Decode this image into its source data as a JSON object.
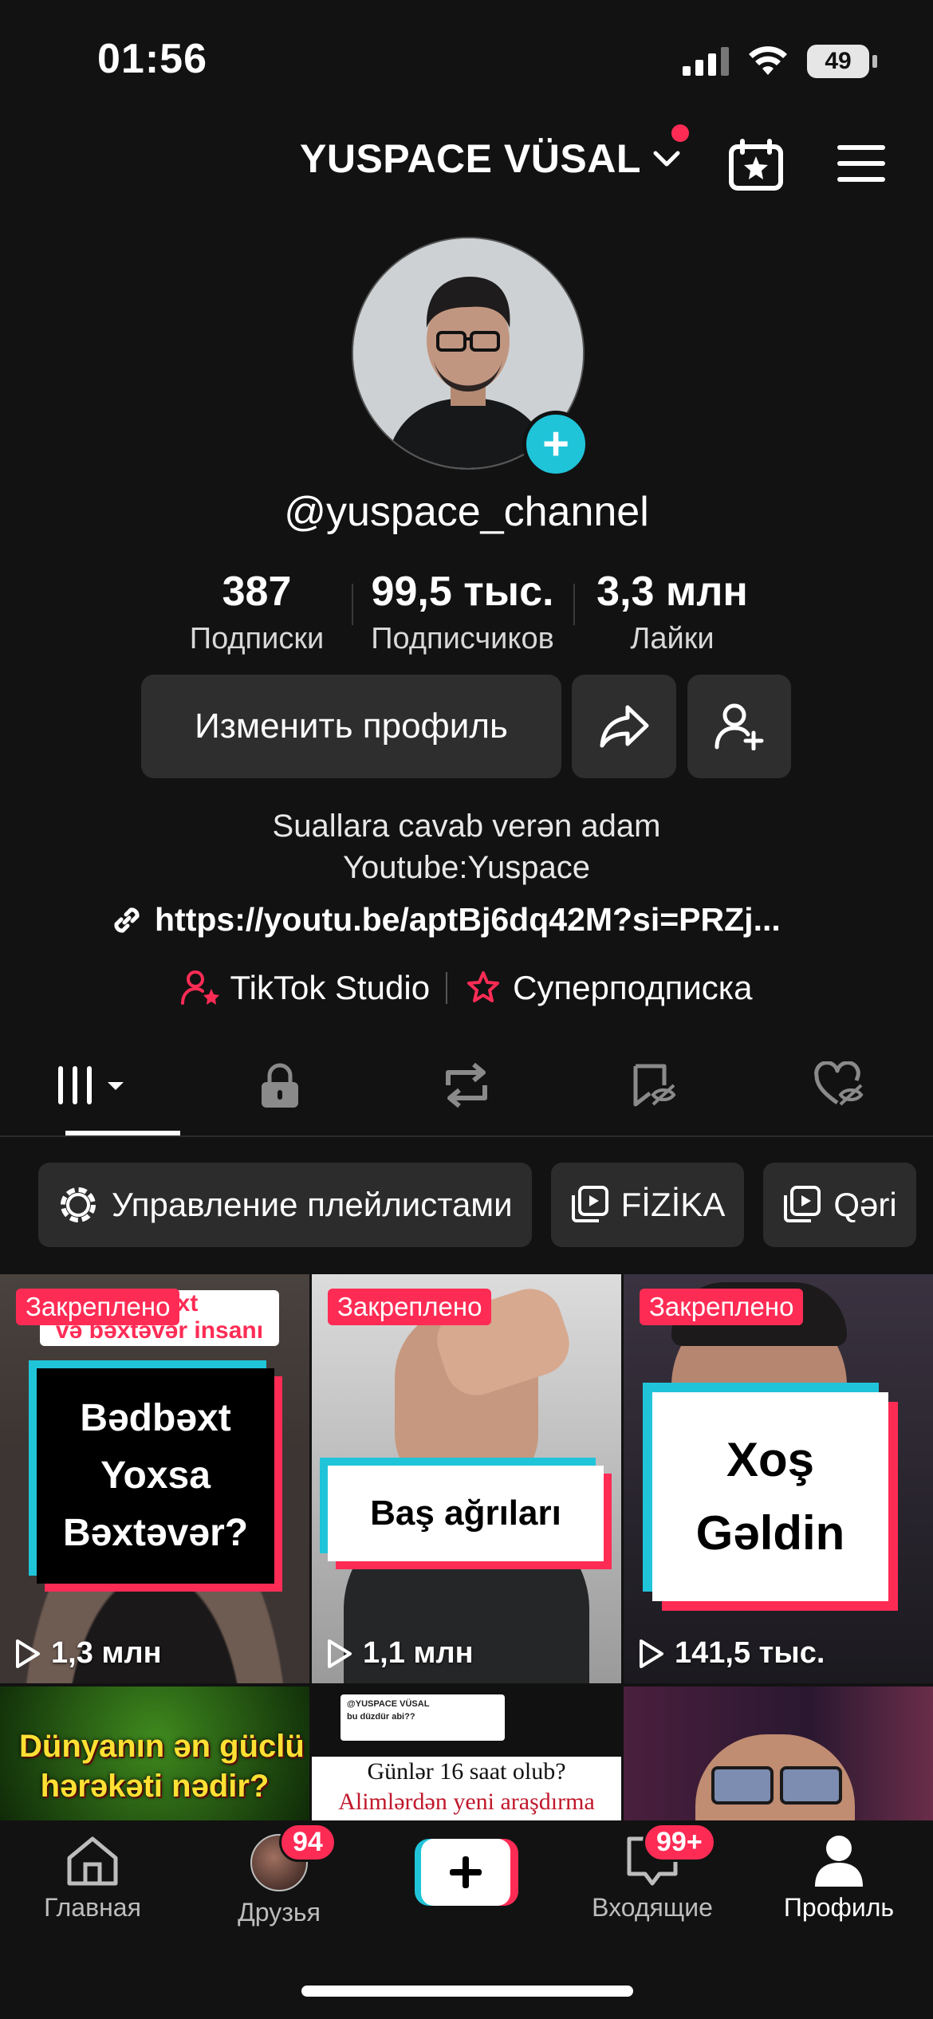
{
  "status_bar": {
    "time": "01:56",
    "battery": "49"
  },
  "header": {
    "username": "YUSPACE VÜSAL"
  },
  "profile": {
    "handle": "@yuspace_channel",
    "stats": [
      {
        "value": "387",
        "label": "Подписки"
      },
      {
        "value": "99,5 тыс.",
        "label": "Подписчиков"
      },
      {
        "value": "3,3 млн",
        "label": "Лайки"
      }
    ],
    "edit_button": "Изменить профиль",
    "bio_line1": "Suallara cavab verən adam",
    "bio_line2": "Youtube:Yuspace",
    "link": "https://youtu.be/aptBj6dq42M?si=PRZj...",
    "studio": "TikTok Studio",
    "subscription": "Суперподписка"
  },
  "playlists": {
    "manage": "Управление плейлистами",
    "items": [
      "FİZİKA",
      "Qəri"
    ]
  },
  "videos": [
    {
      "pinned": "Закреплено",
      "views": "1,3 млн",
      "cover_top": "ədbəxt\nvə bəxtəvər insanı",
      "cover": "Bədbəxt\nYoxsa\nBəxtəvər?"
    },
    {
      "pinned": "Закреплено",
      "views": "1,1 млн",
      "cover": "Baş ağrıları"
    },
    {
      "pinned": "Закреплено",
      "views": "141,5 тыс.",
      "cover": "Xoş\nGəldin"
    },
    {
      "cover": "Dünyanın ən güclü\nhərəkəti nədir?"
    },
    {
      "cover_top": "@YUSPACE VÜSAL\nbu düzdür abi??",
      "cover": "Günlər 16 saat olub?",
      "cover_sub": "Alimlərdən yeni araşdırma"
    },
    {
      "cover": ""
    }
  ],
  "nav": {
    "home": "Главная",
    "friends": "Друзья",
    "friends_badge": "94",
    "inbox": "Входящие",
    "inbox_badge": "99+",
    "profile": "Профиль"
  },
  "colors": {
    "accent": "#fe2c55",
    "cyan": "#20c4d9",
    "background": "#121212"
  }
}
